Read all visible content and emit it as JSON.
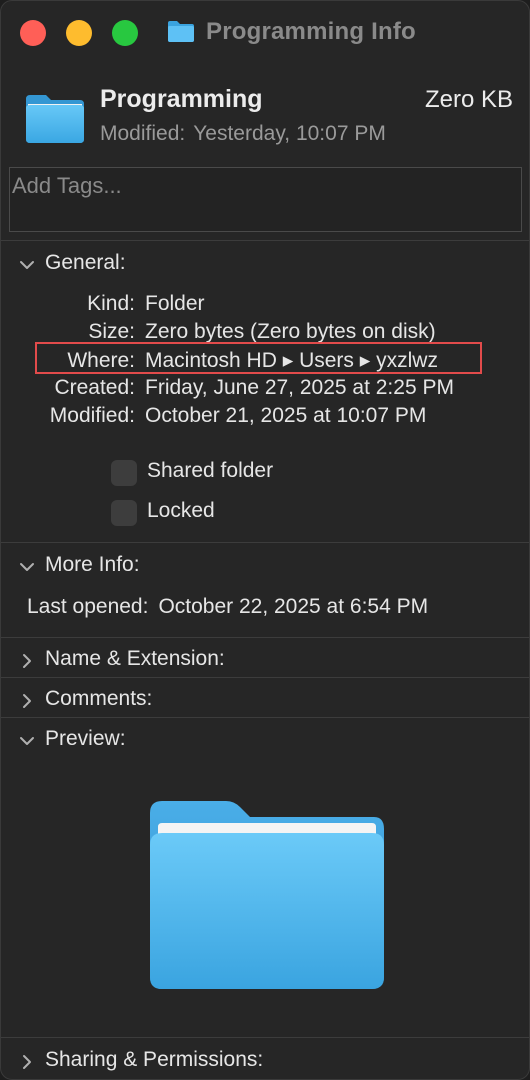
{
  "window": {
    "title": "Programming Info"
  },
  "header": {
    "name": "Programming",
    "size": "Zero KB",
    "modified_label": "Modified:",
    "modified_value": "Yesterday, 10:07 PM"
  },
  "tags": {
    "placeholder": "Add Tags..."
  },
  "general": {
    "title": "General:",
    "rows": [
      {
        "key": "Kind:",
        "value": "Folder"
      },
      {
        "key": "Size:",
        "value": "Zero bytes (Zero bytes on disk)"
      },
      {
        "key": "Where:",
        "value": "Macintosh HD ▸ Users ▸ yxzlwz"
      },
      {
        "key": "Created:",
        "value": "Friday, June 27, 2025 at 2:25 PM"
      },
      {
        "key": "Modified:",
        "value": "October 21, 2025 at 10:07 PM"
      }
    ],
    "checkboxes": [
      {
        "label": "Shared folder",
        "checked": false
      },
      {
        "label": "Locked",
        "checked": false
      }
    ]
  },
  "more_info": {
    "title": "More Info:",
    "last_opened_label": "Last opened:",
    "last_opened_value": "October 22, 2025 at 6:54 PM"
  },
  "sections": {
    "name_extension": "Name & Extension:",
    "comments": "Comments:",
    "preview": "Preview:",
    "sharing": "Sharing & Permissions:"
  },
  "colors": {
    "accent_folder_top": "#5ec1f5",
    "accent_folder_bottom": "#3aa3df",
    "highlight": "#e24b4b"
  },
  "icons": {
    "folder": "folder-icon",
    "chevron_down": "chevron-down-icon",
    "chevron_right": "chevron-right-icon"
  }
}
